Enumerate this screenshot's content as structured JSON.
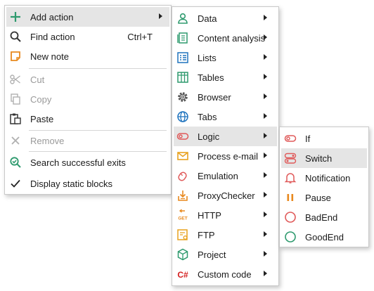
{
  "main_menu": {
    "add_action": "Add action",
    "find_action": "Find action",
    "find_shortcut": "Ctrl+T",
    "new_note": "New note",
    "cut": "Cut",
    "copy": "Copy",
    "paste": "Paste",
    "remove": "Remove",
    "search_exits": "Search successful exits",
    "display_blocks": "Display static blocks"
  },
  "add_action_menu": {
    "items": [
      {
        "label": "Data",
        "icon": "user-icon"
      },
      {
        "label": "Content analysis",
        "icon": "document-analysis-icon"
      },
      {
        "label": "Lists",
        "icon": "list-icon"
      },
      {
        "label": "Tables",
        "icon": "table-icon"
      },
      {
        "label": "Browser",
        "icon": "gear-icon"
      },
      {
        "label": "Tabs",
        "icon": "globe-icon"
      },
      {
        "label": "Logic",
        "icon": "toggle-icon"
      },
      {
        "label": "Process e-mail",
        "icon": "envelope-icon"
      },
      {
        "label": "Emulation",
        "icon": "mouse-icon"
      },
      {
        "label": "ProxyChecker",
        "icon": "proxy-download-icon"
      },
      {
        "label": "HTTP",
        "icon": "http-get-icon"
      },
      {
        "label": "FTP",
        "icon": "ftp-icon"
      },
      {
        "label": "Project",
        "icon": "cube-icon"
      },
      {
        "label": "Custom code",
        "icon": "csharp-icon"
      }
    ],
    "get_badge": "GET",
    "csharp_badge": "C#"
  },
  "logic_menu": {
    "items": [
      {
        "label": "If",
        "icon": "toggle-icon"
      },
      {
        "label": "Switch",
        "icon": "switch-icon"
      },
      {
        "label": "Notification",
        "icon": "bell-icon"
      },
      {
        "label": "Pause",
        "icon": "pause-icon"
      },
      {
        "label": "BadEnd",
        "icon": "circle-red-icon"
      },
      {
        "label": "GoodEnd",
        "icon": "circle-green-icon"
      }
    ]
  },
  "colors": {
    "highlight": "#e5e5e5",
    "green": "#2e9a6e",
    "blue": "#1e73be",
    "orange": "#e8891e",
    "red": "#e05a5a",
    "disabled": "#9a9a9a"
  }
}
